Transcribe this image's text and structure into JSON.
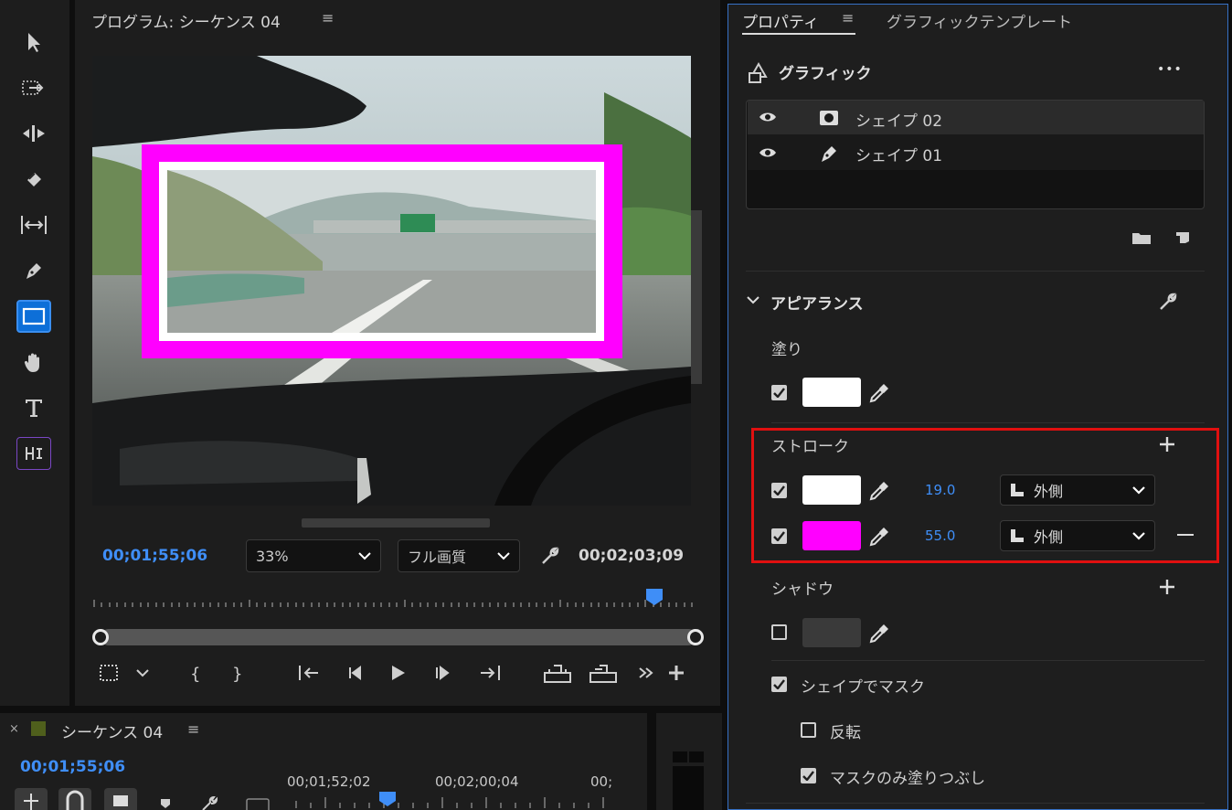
{
  "program_monitor": {
    "title": "プログラム: シーケンス 04",
    "menu_icon": "≡",
    "current_timecode": "00;01;55;06",
    "zoom": "33%",
    "quality": "フル画質",
    "duration_timecode": "00;02;03;09"
  },
  "tools": [
    "selection-tool",
    "track-select-forward-tool",
    "ripple-edit-tool",
    "razor-tool",
    "slip-tool",
    "pen-tool",
    "rectangle-tool",
    "hand-tool",
    "type-tool",
    "remix-tool"
  ],
  "properties": {
    "tab_properties": "プロパティ",
    "tab_menu": "≡",
    "tab_graphic_templates": "グラフィックテンプレート",
    "graphic_header": "グラフィック",
    "more": "•••",
    "layers": [
      {
        "name": "シェイプ 02",
        "icon": "shape-mask-icon"
      },
      {
        "name": "シェイプ 01",
        "icon": "pen-icon"
      }
    ],
    "appearance": {
      "title": "アピアランス",
      "fill_label": "塗り",
      "fill": {
        "checked": true,
        "color": "#ffffff"
      },
      "stroke_label": "ストローク",
      "strokes": [
        {
          "checked": true,
          "color": "#ffffff",
          "width": "19.0",
          "position": "外側"
        },
        {
          "checked": true,
          "color": "#ff00ff",
          "width": "55.0",
          "position": "外側"
        }
      ],
      "shadow_label": "シャドウ",
      "shadow": {
        "checked": false,
        "color": "#3a3a3a"
      },
      "mask_with_shape": "シェイプでマスク",
      "invert": "反転",
      "fill_mask_only": "マスクのみ塗りつぶし"
    }
  },
  "timeline": {
    "sequence": "シーケンス 04",
    "timecode": "00;01;55;06",
    "ruler": [
      "00;01;52;02",
      "00;02;00;04",
      "00;"
    ]
  },
  "colors": {
    "accent_blue": "#3f8ef7",
    "highlight_red": "#e01010",
    "magenta": "#ff00ff"
  }
}
